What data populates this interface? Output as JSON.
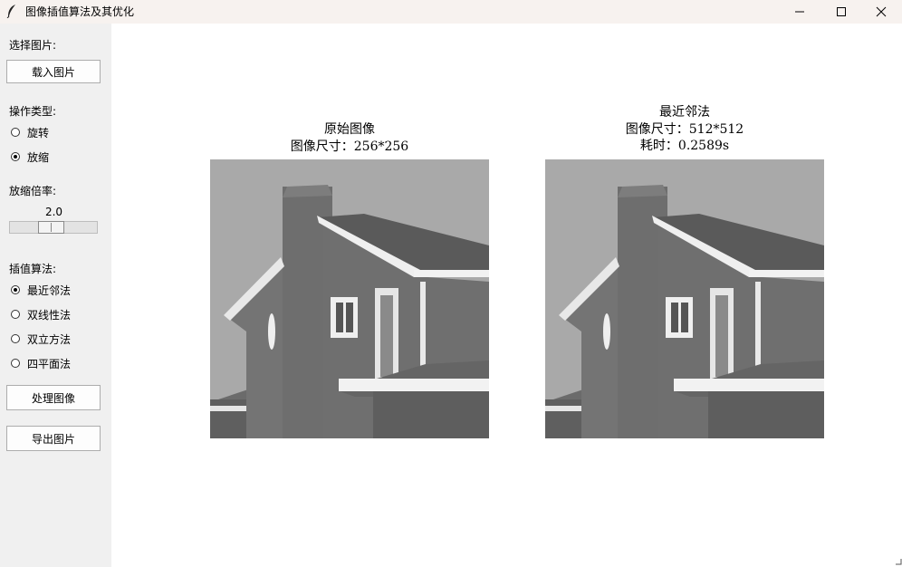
{
  "window": {
    "title": "图像插值算法及其优化",
    "controls": {
      "minimize": "—",
      "maximize": "☐",
      "close": "✕"
    }
  },
  "sidebar": {
    "select_image_label": "选择图片:",
    "load_button": "载入图片",
    "operation_label": "操作类型:",
    "operations": [
      {
        "label": "旋转",
        "selected": false
      },
      {
        "label": "放缩",
        "selected": true
      }
    ],
    "scale_label": "放缩倍率:",
    "scale_value": "2.0",
    "scale_fraction": 0.46,
    "algorithm_label": "插值算法:",
    "algorithms": [
      {
        "label": "最近邻法",
        "selected": true
      },
      {
        "label": "双线性法",
        "selected": false
      },
      {
        "label": "双立方法",
        "selected": false
      },
      {
        "label": "四平面法",
        "selected": false
      }
    ],
    "process_button": "处理图像",
    "export_button": "导出图片"
  },
  "original": {
    "title": "原始图像",
    "size": "图像尺寸：256*256"
  },
  "result": {
    "title": "最近邻法",
    "size": "图像尺寸：512*512",
    "time": "耗时：0.2589s"
  },
  "colors": {
    "titlebar": "#f7f2ef",
    "sidebar": "#f0f0f0",
    "canvas": "#ffffff"
  }
}
